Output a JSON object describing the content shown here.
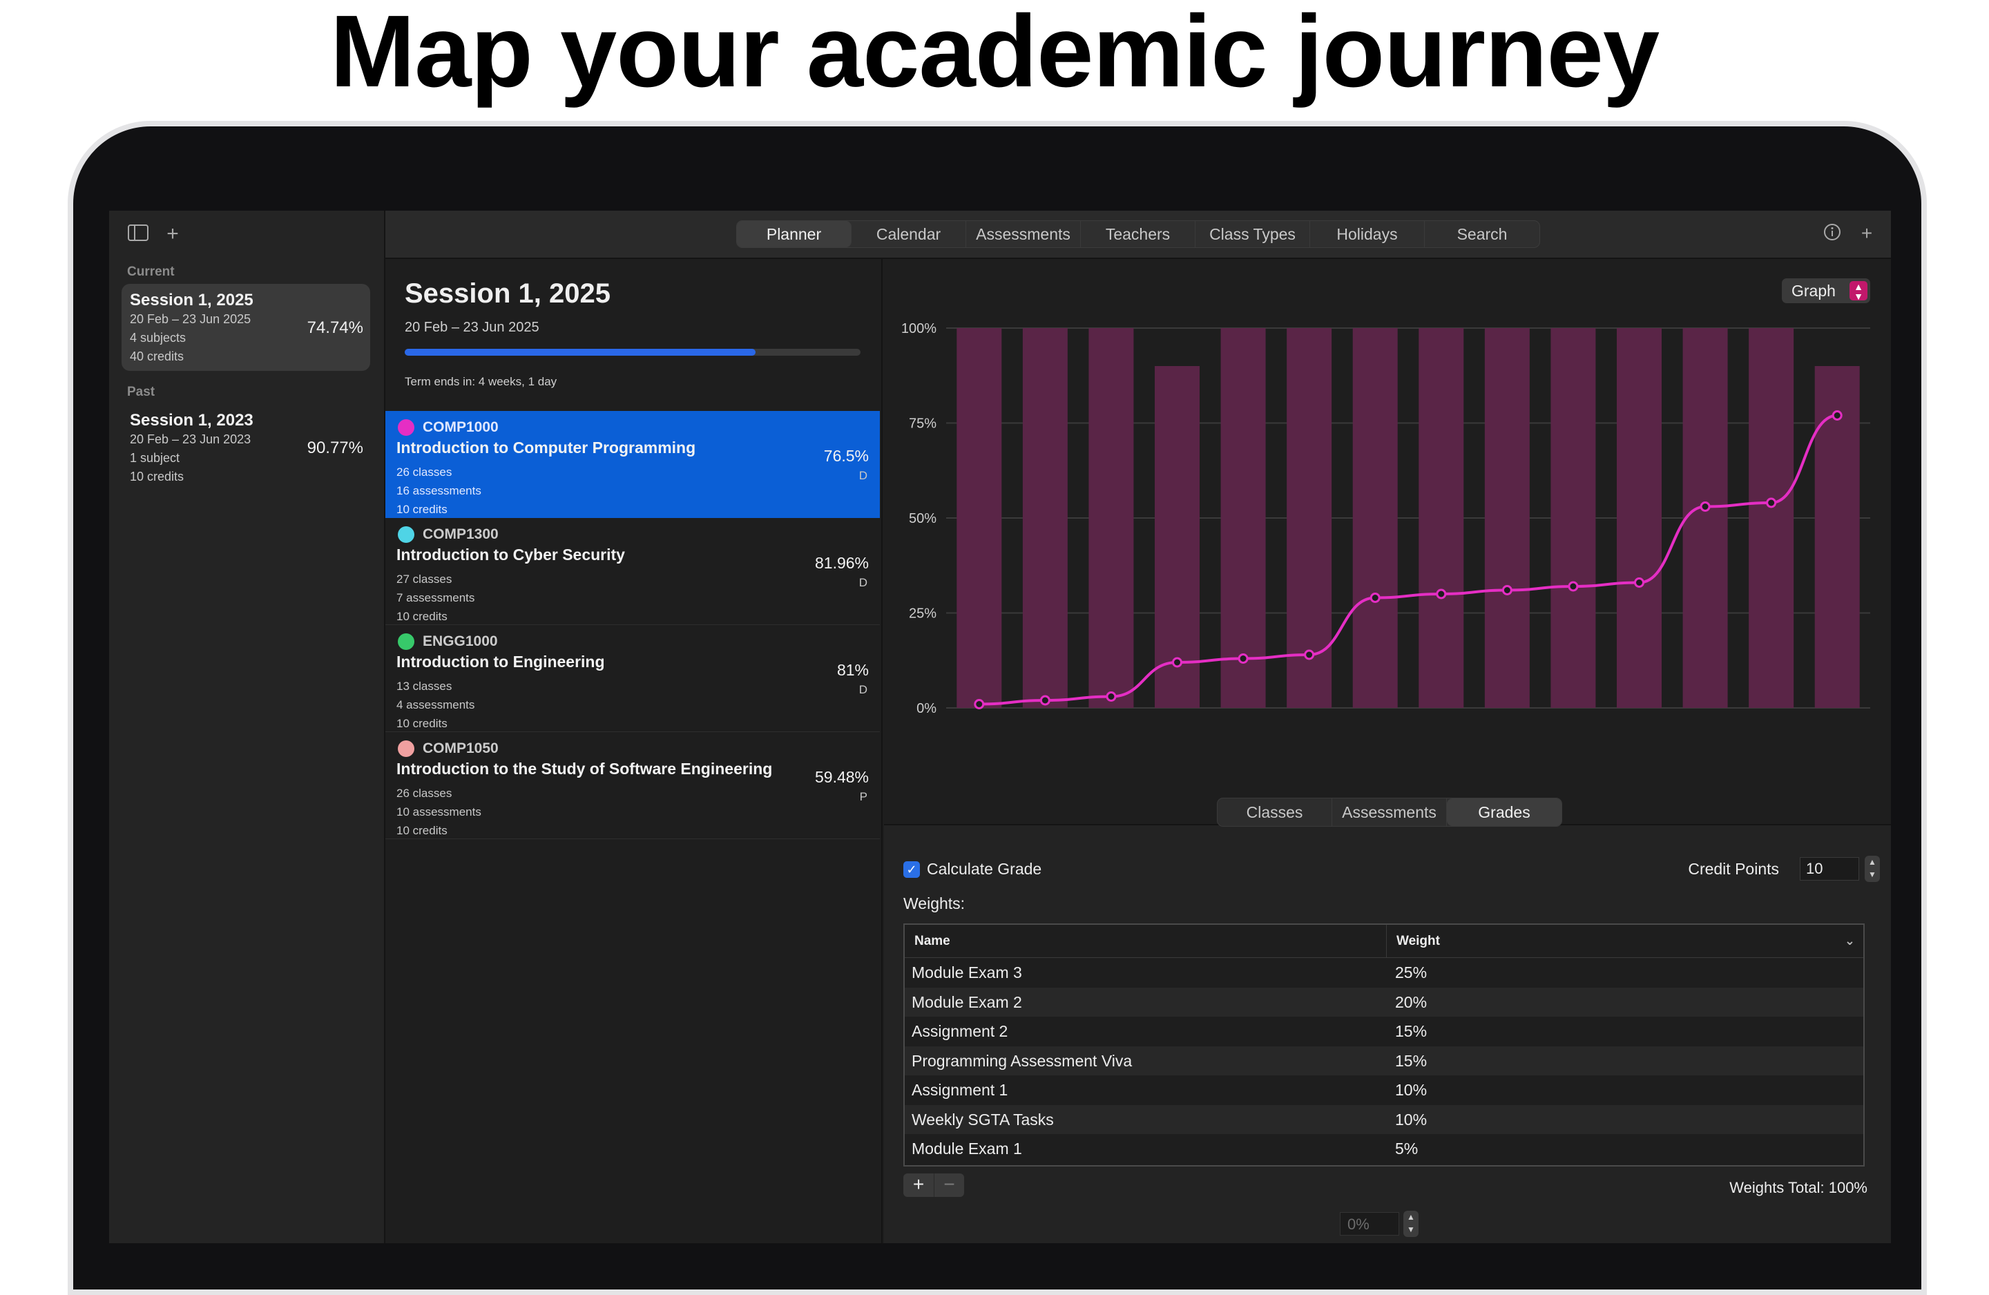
{
  "headline": "Map your academic journey",
  "sidebar": {
    "current_label": "Current",
    "past_label": "Past",
    "sessions": [
      {
        "title": "Session 1, 2025",
        "range": "20 Feb – 23 Jun 2025",
        "subjects": "4 subjects",
        "credits": "40 credits",
        "percent": "74.74%"
      },
      {
        "title": "Session 1, 2023",
        "range": "20 Feb – 23 Jun 2023",
        "subjects": "1 subject",
        "credits": "10 credits",
        "percent": "90.77%"
      }
    ]
  },
  "toolbar": {
    "tabs": [
      "Planner",
      "Calendar",
      "Assessments",
      "Teachers",
      "Class Types",
      "Holidays",
      "Search"
    ],
    "active_tab": "Planner"
  },
  "session_detail": {
    "title": "Session 1, 2025",
    "range": "20 Feb – 23 Jun 2025",
    "progress": 0.77,
    "term_ends": "Term ends in: 4 weeks, 1 day",
    "subjects": [
      {
        "color": "#e52ec4",
        "code": "COMP1000",
        "name": "Introduction to Computer Programming",
        "classes": "26 classes",
        "assessments": "16 assessments",
        "credits": "10 credits",
        "percent": "76.5%",
        "grade": "D"
      },
      {
        "color": "#4fd4e6",
        "code": "COMP1300",
        "name": "Introduction to Cyber Security",
        "classes": "27 classes",
        "assessments": "7 assessments",
        "credits": "10 credits",
        "percent": "81.96%",
        "grade": "D"
      },
      {
        "color": "#37c96a",
        "code": "ENGG1000",
        "name": "Introduction to Engineering",
        "classes": "13 classes",
        "assessments": "4 assessments",
        "credits": "10 credits",
        "percent": "81%",
        "grade": "D"
      },
      {
        "color": "#f0a0a0",
        "code": "COMP1050",
        "name": "Introduction to the Study of Software Engineering",
        "classes": "26 classes",
        "assessments": "10 assessments",
        "credits": "10 credits",
        "percent": "59.48%",
        "grade": "P"
      }
    ]
  },
  "graph_toggle": "Graph",
  "chart_data": {
    "type": "bar",
    "y_ticks": [
      "0%",
      "25%",
      "50%",
      "75%",
      "100%"
    ],
    "ylim": [
      0,
      100
    ],
    "series": [
      {
        "values": [
          100,
          100,
          100,
          90,
          100,
          100,
          100,
          100,
          100,
          100,
          100,
          100,
          100,
          90
        ],
        "color": "#5a2547"
      },
      {
        "values": [
          1,
          2,
          3,
          12,
          13,
          14,
          29,
          30,
          31,
          32,
          33,
          53,
          54,
          77
        ],
        "color": "#e52ec4"
      }
    ]
  },
  "bottom_tabs": [
    "Classes",
    "Assessments",
    "Grades"
  ],
  "bottom_active": "Grades",
  "grades": {
    "calculate_label": "Calculate Grade",
    "credit_label": "Credit Points",
    "credit_value": "10",
    "weights_label": "Weights:",
    "columns": [
      "Name",
      "Weight"
    ],
    "rows": [
      {
        "name": "Module Exam 3",
        "weight": "25%"
      },
      {
        "name": "Module Exam 2",
        "weight": "20%"
      },
      {
        "name": "Assignment 2",
        "weight": "15%"
      },
      {
        "name": "Programming Assessment Viva",
        "weight": "15%"
      },
      {
        "name": "Assignment 1",
        "weight": "10%"
      },
      {
        "name": "Weekly SGTA Tasks",
        "weight": "10%"
      },
      {
        "name": "Module Exam 1",
        "weight": "5%"
      }
    ],
    "total": "Weights Total: 100%",
    "percent_placeholder": "0%"
  }
}
